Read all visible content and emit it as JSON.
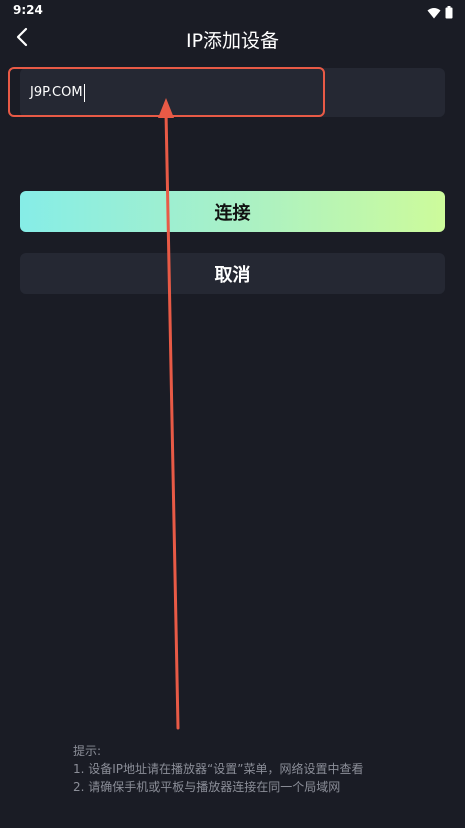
{
  "status_bar": {
    "time": "9:24",
    "icons": [
      "wifi-icon",
      "battery-icon"
    ]
  },
  "header": {
    "back_icon": "chevron-left-icon",
    "title": "IP添加设备"
  },
  "ip_input": {
    "value": "J9P.COM"
  },
  "buttons": {
    "connect_label": "连接",
    "cancel_label": "取消"
  },
  "tips": {
    "heading": "提示:",
    "line1": "1. 设备IP地址请在播放器“设置”菜单，网络设置中查看",
    "line2": "2. 请确保手机或平板与播放器连接在同一个局域网"
  },
  "colors": {
    "background": "#1a1c25",
    "surface": "#252833",
    "annotation": "#e85a46",
    "gradient_start": "#86ede7",
    "gradient_end": "#cdfb9b",
    "tip_text": "#8b8e98"
  }
}
